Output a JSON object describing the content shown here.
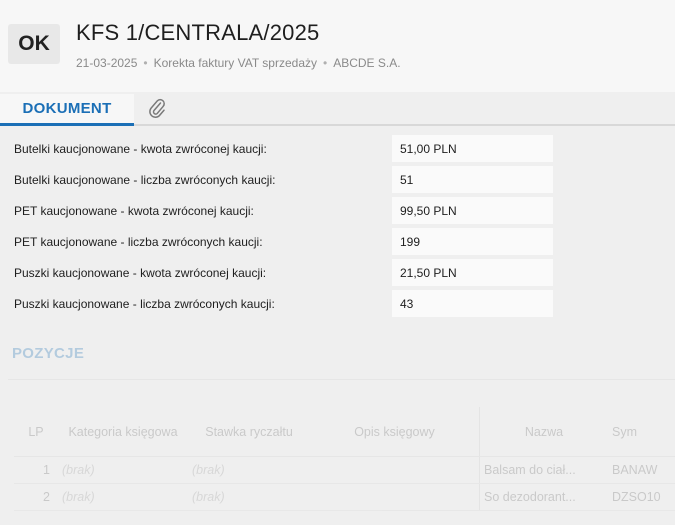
{
  "header": {
    "status_badge": "OK",
    "title": "KFS 1/CENTRALA/2025",
    "date": "21-03-2025",
    "doc_type": "Korekta faktury VAT sprzedaży",
    "company": "ABCDE S.A.",
    "separator": "•"
  },
  "tabs": {
    "document_label": "DOKUMENT",
    "attachment_icon": "paperclip-icon"
  },
  "fields": [
    {
      "label": "Butelki kaucjonowane - kwota zwróconej kaucji:",
      "value": "51,00 PLN"
    },
    {
      "label": "Butelki kaucjonowane - liczba zwróconych kaucji:",
      "value": "51"
    },
    {
      "label": "PET kaucjonowane - kwota zwróconej kaucji:",
      "value": "99,50 PLN"
    },
    {
      "label": "PET kaucjonowane - liczba zwróconych kaucji:",
      "value": "199"
    },
    {
      "label": "Puszki kaucjonowane - kwota zwróconej kaucji:",
      "value": "21,50 PLN"
    },
    {
      "label": "Puszki kaucjonowane - liczba zwróconych kaucji:",
      "value": "43"
    }
  ],
  "positions": {
    "title": "POZYCJE",
    "columns": {
      "lp": "LP",
      "kategoria": "Kategoria księgowa",
      "stawka": "Stawka ryczałtu",
      "opis": "Opis księgowy",
      "nazwa": "Nazwa",
      "symbol": "Sym"
    },
    "rows": [
      {
        "lp": "1",
        "kategoria": "(brak)",
        "stawka": "(brak)",
        "opis": "",
        "nazwa": "Balsam do ciał...",
        "symbol": "BANAW"
      },
      {
        "lp": "2",
        "kategoria": "(brak)",
        "stawka": "(brak)",
        "opis": "",
        "nazwa": "So dezodorant...",
        "symbol": "DZSO10"
      }
    ]
  },
  "colors": {
    "accent": "#1b6fb6",
    "background": "#efefef"
  }
}
